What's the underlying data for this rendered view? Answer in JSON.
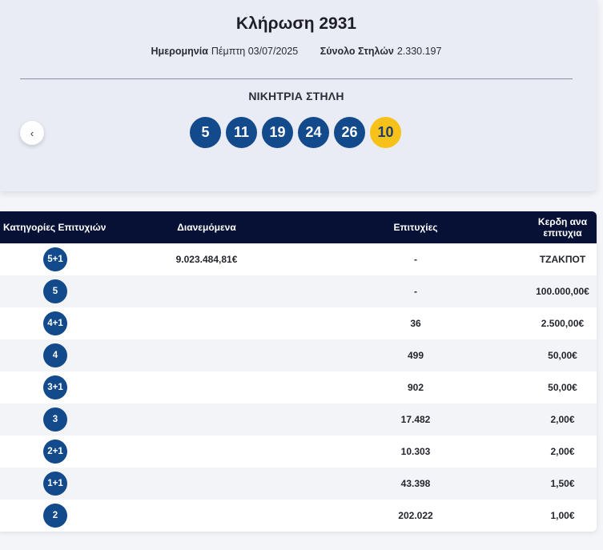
{
  "draw": {
    "title": "Κλήρωση 2931",
    "date_label": "Ημερομηνία",
    "date_value": "Πέμπτη 03/07/2025",
    "columns_label": "Σύνολο Στηλών",
    "columns_value": "2.330.197",
    "winning_title": "ΝΙΚΗΤΡΙΑ ΣΤΗΛΗ",
    "numbers": [
      "5",
      "11",
      "19",
      "24",
      "26"
    ],
    "joker": "10",
    "prev_icon": "‹"
  },
  "table": {
    "headers": {
      "category": "Κατηγορίες Επιτυχιών",
      "distributed": "Διανεμόμενα",
      "winners": "Επιτυχίες",
      "prize": "Κερδη ανα επιτυχια"
    },
    "rows": [
      {
        "category": "5+1",
        "distributed": "9.023.484,81€",
        "winners": "-",
        "prize": "ΤΖΑΚΠΟΤ"
      },
      {
        "category": "5",
        "distributed": "",
        "winners": "-",
        "prize": "100.000,00€"
      },
      {
        "category": "4+1",
        "distributed": "",
        "winners": "36",
        "prize": "2.500,00€"
      },
      {
        "category": "4",
        "distributed": "",
        "winners": "499",
        "prize": "50,00€"
      },
      {
        "category": "3+1",
        "distributed": "",
        "winners": "902",
        "prize": "50,00€"
      },
      {
        "category": "3",
        "distributed": "",
        "winners": "17.482",
        "prize": "2,00€"
      },
      {
        "category": "2+1",
        "distributed": "",
        "winners": "10.303",
        "prize": "2,00€"
      },
      {
        "category": "1+1",
        "distributed": "",
        "winners": "43.398",
        "prize": "1,50€"
      },
      {
        "category": "2",
        "distributed": "",
        "winners": "202.022",
        "prize": "1,00€"
      }
    ]
  },
  "colors": {
    "ball": "#124a8c",
    "joker": "#f6c219",
    "header_bg": "#061135"
  }
}
